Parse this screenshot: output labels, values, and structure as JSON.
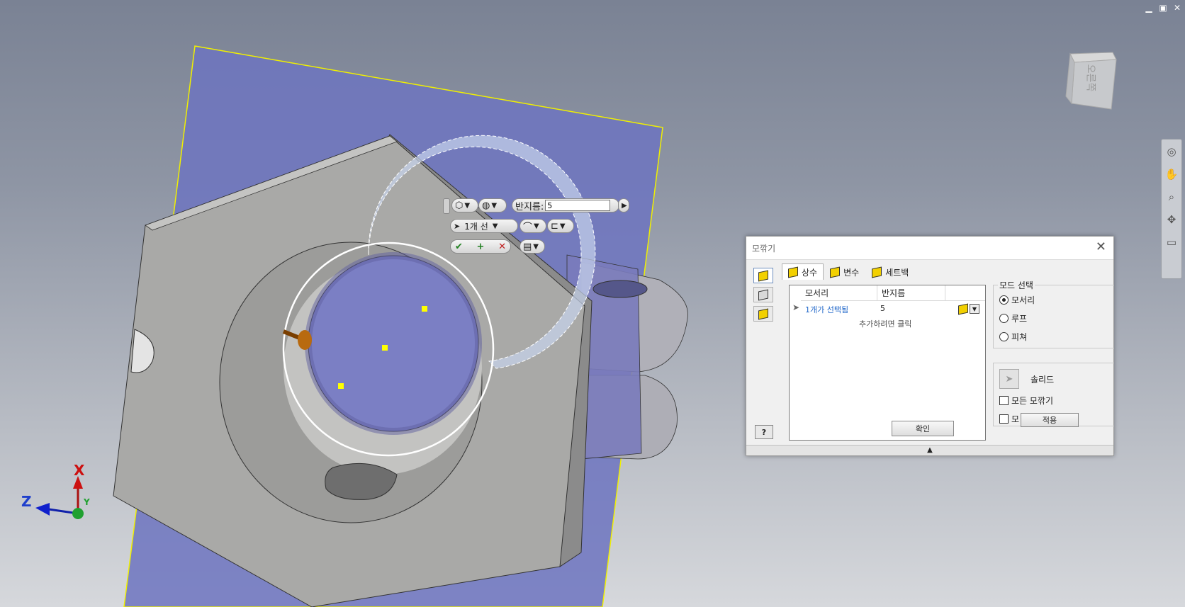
{
  "window": {
    "minimize": "▁",
    "restore": "▣",
    "close": "✕"
  },
  "viewcube": {
    "face_label": "오른쪽"
  },
  "triad": {
    "x": "X",
    "y": "Y",
    "z": "Z"
  },
  "minitoolbar": {
    "radius_label": "반지름:",
    "radius_value": "5",
    "selection_text": "1개 선",
    "ok_icon": "check-icon",
    "add_icon": "plus-icon",
    "cancel_icon": "x-icon"
  },
  "dialog": {
    "title": "모깎기",
    "close": "✕",
    "tabs": [
      {
        "label": "상수",
        "active": true
      },
      {
        "label": "변수",
        "active": false
      },
      {
        "label": "세트백",
        "active": false
      }
    ],
    "grid": {
      "col_edge": "모서리",
      "col_radius": "반지름",
      "row_edge": "1개가 선택됨",
      "row_radius": "5",
      "add_hint": "추가하려면 클릭"
    },
    "ok_button": "확인",
    "mode": {
      "legend": "모드 선택",
      "options": [
        "모서리",
        "루프",
        "피쳐"
      ],
      "selected": "모서리"
    },
    "solid_label": "솔리드",
    "all_fillets": "모든 모깎기",
    "partial_check": "모",
    "apply_button": "적용",
    "help": "?",
    "expand": "▲"
  },
  "colors": {
    "sketch_plane": "#6d74c0",
    "part": "#a9a9a7",
    "fillet_preview": "#b8c8e8",
    "selection": "#ffff00",
    "link_text": "#1f66c9"
  }
}
